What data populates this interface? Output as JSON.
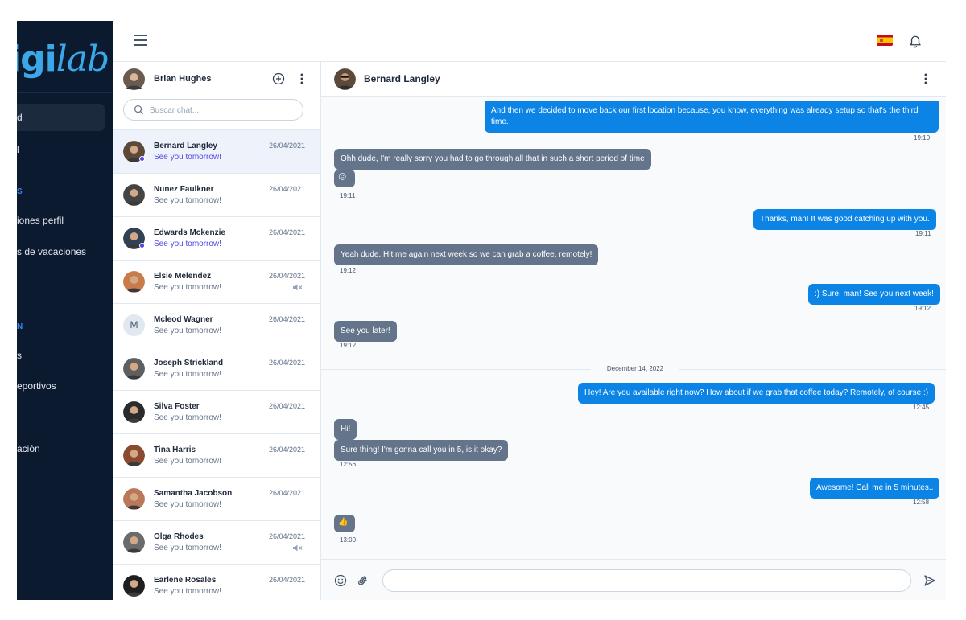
{
  "brand": {
    "logo_text_bold": "igi",
    "logo_text_script": "lab"
  },
  "sidebar": {
    "items": [
      {
        "label": "d",
        "active": true
      },
      {
        "label": "l"
      },
      {
        "label": "S",
        "section": true
      },
      {
        "label": "iones perfil"
      },
      {
        "label": "s de vacaciones"
      },
      {
        "label": "N",
        "section": true
      },
      {
        "label": "s"
      },
      {
        "label": "eportivos"
      },
      {
        "label": "ación"
      }
    ]
  },
  "topbar": {
    "menu_icon": "hamburger-menu-icon",
    "flag": "spain-flag",
    "notifications_icon": "bell-icon"
  },
  "chat_list": {
    "me": {
      "name": "Brian Hughes"
    },
    "search_placeholder": "Buscar chat...",
    "conversations": [
      {
        "name": "Bernard Langley",
        "message": "See you tomorrow!",
        "date": "26/04/2021",
        "unread": true,
        "selected": true,
        "avatar_color": "#5b4a3a"
      },
      {
        "name": "Nunez Faulkner",
        "message": "See you tomorrow!",
        "date": "26/04/2021",
        "avatar_color": "#444444"
      },
      {
        "name": "Edwards Mckenzie",
        "message": "See you tomorrow!",
        "date": "26/04/2021",
        "unread": true,
        "avatar_color": "#334155"
      },
      {
        "name": "Elsie Melendez",
        "message": "See you tomorrow!",
        "date": "26/04/2021",
        "muted": true,
        "avatar_color": "#c97b4a"
      },
      {
        "name": "Mcleod Wagner",
        "message": "See you tomorrow!",
        "date": "26/04/2021",
        "initial": "M"
      },
      {
        "name": "Joseph Strickland",
        "message": "See you tomorrow!",
        "date": "26/04/2021",
        "avatar_color": "#5f5f5f"
      },
      {
        "name": "Silva Foster",
        "message": "See you tomorrow!",
        "date": "26/04/2021",
        "avatar_color": "#2b2b2b"
      },
      {
        "name": "Tina Harris",
        "message": "See you tomorrow!",
        "date": "26/04/2021",
        "avatar_color": "#8a4a2f"
      },
      {
        "name": "Samantha Jacobson",
        "message": "See you tomorrow!",
        "date": "26/04/2021",
        "avatar_color": "#b9785a"
      },
      {
        "name": "Olga Rhodes",
        "message": "See you tomorrow!",
        "date": "26/04/2021",
        "muted": true,
        "avatar_color": "#6b6b6b"
      },
      {
        "name": "Earlene Rosales",
        "message": "See you tomorrow!",
        "date": "26/04/2021",
        "avatar_color": "#1f1f1f"
      }
    ]
  },
  "chat": {
    "contact": {
      "name": "Bernard Langley"
    },
    "messages": [
      {
        "dir": "out",
        "text": "And then we decided to move back our first location because, you know, everything was already setup so that's the third time.",
        "time": "19:10"
      },
      {
        "dir": "in",
        "text": "Ohh dude, I'm really sorry you had to go through all that in such a short period of time"
      },
      {
        "dir": "in",
        "text": "😐",
        "time": "19:11"
      },
      {
        "dir": "out",
        "text": "Thanks, man! It was good catching up with you.",
        "time": "19:11"
      },
      {
        "dir": "in",
        "text": "Yeah dude. Hit me again next week so we can grab a coffee, remotely!",
        "time": "19:12"
      },
      {
        "dir": "out",
        "text": ":) Sure, man! See you next week!",
        "time": "19:12"
      },
      {
        "dir": "in",
        "text": "See you later!",
        "time": "19:12"
      },
      {
        "dir": "out",
        "text": "Hey! Are you available right now? How about if we grab that coffee today? Remotely, of course :)",
        "time": "12:45"
      },
      {
        "dir": "in",
        "text": "Hi!"
      },
      {
        "dir": "in",
        "text": "Sure thing! I'm gonna call you in 5, is it okay?",
        "time": "12:56"
      },
      {
        "dir": "out",
        "text": "Awesome! Call me in 5 minutes..",
        "time": "12:58"
      },
      {
        "dir": "in",
        "text": "👍",
        "time": "13:00"
      }
    ],
    "day_separator": "December 14, 2022",
    "composer": {
      "placeholder": ""
    }
  },
  "colors": {
    "sidebar_bg": "#0b1a2e",
    "outgoing": "#0b84e6",
    "incoming": "#64748b",
    "accent": "#4f46e5"
  }
}
